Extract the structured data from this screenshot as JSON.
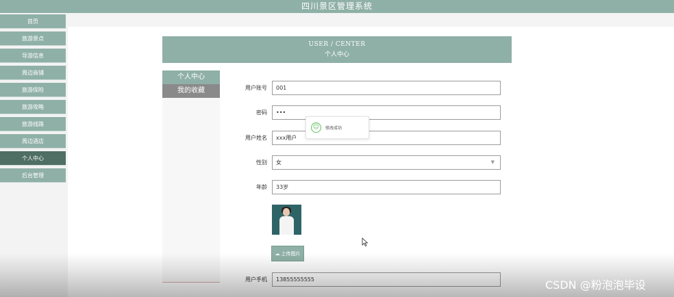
{
  "app": {
    "title": "四川景区管理系统"
  },
  "sidebar": {
    "items": [
      {
        "label": "首页",
        "active": false
      },
      {
        "label": "旅游景点",
        "active": false
      },
      {
        "label": "导游信息",
        "active": false
      },
      {
        "label": "周边商铺",
        "active": false
      },
      {
        "label": "旅游保险",
        "active": false
      },
      {
        "label": "旅游攻略",
        "active": false
      },
      {
        "label": "旅游线路",
        "active": false
      },
      {
        "label": "周边酒店",
        "active": false
      },
      {
        "label": "个人中心",
        "active": true
      },
      {
        "label": "后台管理",
        "active": false
      }
    ]
  },
  "panel": {
    "title_en": "USER / CENTER",
    "title_cn": "个人中心"
  },
  "subnav": {
    "items": [
      {
        "label": "个人中心"
      },
      {
        "label": "我的收藏"
      }
    ]
  },
  "form": {
    "account": {
      "label": "用户账号",
      "value": "001"
    },
    "password": {
      "label": "密码",
      "value": "•••"
    },
    "name": {
      "label": "用户姓名",
      "value": "xxx用户"
    },
    "gender": {
      "label": "性别",
      "value": "女"
    },
    "age": {
      "label": "年龄",
      "value": "33岁"
    },
    "upload_label": "上传图片",
    "phone": {
      "label": "用户手机",
      "value": "13855555555"
    }
  },
  "toast": {
    "message": "修改成功"
  },
  "watermark": "CSDN @粉泡泡毕设",
  "colors": {
    "accent": "#8fb0a6",
    "active": "#4f6e64",
    "gray": "#8a8a8a",
    "success": "#5fbf5f"
  }
}
